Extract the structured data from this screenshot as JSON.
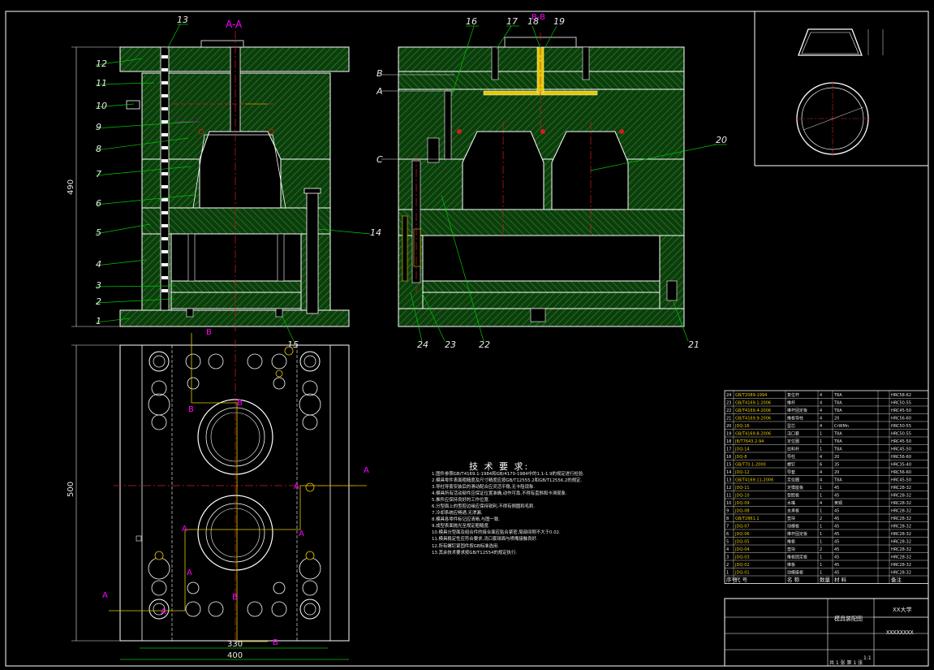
{
  "drawing": {
    "section_aa": "A-A",
    "section_bb": "B-B",
    "dims": {
      "overall_height": "490",
      "plate_height": "500",
      "inner_width": "330",
      "overall_width": "400"
    },
    "plane_marks": [
      "B",
      "A",
      "C"
    ],
    "section_marks": {
      "A": "A",
      "B": "B"
    },
    "balloons_left": [
      "13",
      "12",
      "11",
      "10",
      "9",
      "8",
      "7",
      "6",
      "5",
      "4",
      "3",
      "2",
      "1"
    ],
    "balloons_mid": [
      "16",
      "17",
      "18",
      "19",
      "20",
      "14",
      "15",
      "21",
      "22",
      "23",
      "24"
    ]
  },
  "tech_requirements": {
    "title": "技 术 要 求:",
    "items": [
      "1.图件参照GB/T4169.1-1984和GB/4170-1984中的1.1-1.9的规定进行检验.",
      "2.模具零件表面粗糙度及尺寸精度应按GB/T12555.2和GB/T12556.2的规定.",
      "3.导柱导套安装后的滑动配合应灵活平稳,无卡阻现象.",
      "4.模具所有活动部件应保证位置准确,动作可靠,不得有歪斜和卡滞现象.",
      "5.推件应保持良好的工作位置.",
      "6.分型面上的型腔边缘应保持锐利,不得有倒圆和毛刺.",
      "7.冷却系统应畅通,无渗漏.",
      "8.模具各零件标记应清晰,与图一致.",
      "9.成型表面抛光至规定粗糙度.",
      "10.模具分型面及组合件的接合面应贴合紧密,局部间隙不大于0.02.",
      "11.模具稳定性应符合要求,浇口套球面与喷嘴接触良好.",
      "12.所有螺钉紧固件按GB标准选用.",
      "13.其余技术要求按GB/T12554的规定执行."
    ]
  },
  "bom": {
    "rows": [
      [
        "24",
        "GB/T2089-1994",
        "复位杆",
        "4",
        "T8A",
        "HRC58-62"
      ],
      [
        "23",
        "GB/T4169.1-2006",
        "推杆",
        "4",
        "T8A",
        "HRC50-55"
      ],
      [
        "22",
        "GB/T4169.4-2006",
        "推杆固定板",
        "4",
        "T8A",
        "HRC45-50"
      ],
      [
        "21",
        "GB/T4169.9-2006",
        "推板导柱",
        "4",
        "20",
        "HRC56-60"
      ],
      [
        "20",
        "JDQ-16",
        "型芯",
        "4",
        "CrWMn",
        "HRC50-55"
      ],
      [
        "19",
        "GB/T4169.8-2006",
        "浇口套",
        "1",
        "T8A",
        "HRC50-55"
      ],
      [
        "18",
        "JB/T7643.2-94",
        "定位圈",
        "1",
        "T8A",
        "HRC45-50"
      ],
      [
        "17",
        "JDQ-14",
        "拉料杆",
        "1",
        "T8A",
        "HRC45-50"
      ],
      [
        "16",
        "JDQ-8",
        "导柱",
        "4",
        "20",
        "HRC56-60"
      ],
      [
        "15",
        "GB/T70.1-2000",
        "螺钉",
        "6",
        "35",
        "HRC35-40"
      ],
      [
        "14",
        "JDQ-12",
        "导套",
        "4",
        "20",
        "HRC56-60"
      ],
      [
        "13",
        "GB/T4169.11-2006",
        "定位圈",
        "4",
        "T8A",
        "HRC45-50"
      ],
      [
        "12",
        "JDQ-11",
        "定模座板",
        "1",
        "45",
        "HRC28-32"
      ],
      [
        "11",
        "JDQ-10",
        "型腔板",
        "1",
        "45",
        "HRC28-32"
      ],
      [
        "10",
        "JDQ-09",
        "水嘴",
        "4",
        "黄铜",
        "HRC28-32"
      ],
      [
        "9",
        "JDQ-08",
        "支承板",
        "1",
        "45",
        "HRC28-32"
      ],
      [
        "8",
        "GB/T2861.1",
        "垫块",
        "2",
        "45",
        "HRC28-32"
      ],
      [
        "7",
        "JDQ-07",
        "动模板",
        "1",
        "45",
        "HRC28-32"
      ],
      [
        "6",
        "JDQ-06",
        "推杆固定板",
        "1",
        "45",
        "HRC28-32"
      ],
      [
        "5",
        "JDQ-05",
        "推板",
        "1",
        "45",
        "HRC28-32"
      ],
      [
        "4",
        "JDQ-04",
        "垫块",
        "2",
        "45",
        "HRC28-32"
      ],
      [
        "3",
        "JDQ-03",
        "推板固定板",
        "1",
        "45",
        "HRC28-32"
      ],
      [
        "2",
        "JDQ-02",
        "推板",
        "1",
        "45",
        "HRC28-32"
      ],
      [
        "1",
        "JDQ-01",
        "动模座板",
        "1",
        "45",
        "HRC28-32"
      ]
    ],
    "header": [
      "序号",
      "代 号",
      "名 称",
      "数量",
      "材 料",
      "备注"
    ]
  },
  "title_block": {
    "drawing_name": "模具装配图",
    "school": "XX大学",
    "code": "XXXXXXXX",
    "scale": "1:1",
    "sheet_info": "共 1 张  第 1 张"
  },
  "colors": {
    "background": "#000000",
    "outline": "#ffffff",
    "hatch": "#2f8f2f",
    "plate_fill": "#0d3d0d",
    "leader": "#00c800",
    "center": "#d21e1e",
    "dim": "#e8e8e8",
    "yellow": "#e6c800",
    "magenta": "#ff00ff",
    "cyan": "#00c8c8"
  }
}
